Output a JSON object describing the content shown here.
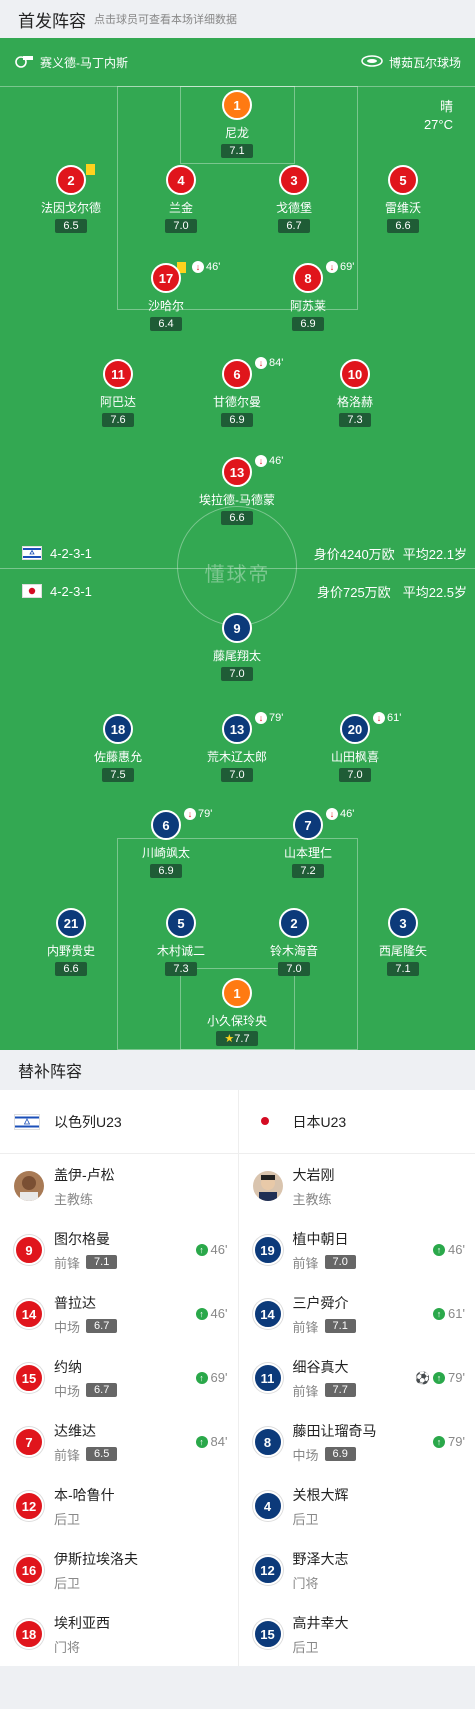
{
  "header": {
    "title": "首发阵容",
    "subtitle": "点击球员可查看本场详细数据"
  },
  "pitch": {
    "coach_left": "赛义德-马丁内斯",
    "stadium": "博茹瓦尔球场",
    "weather": "晴",
    "temperature": "27°C",
    "watermark": "懂球帝",
    "home_formation": {
      "formation": "4-2-3-1",
      "value": "身价4240万欧",
      "age": "平均22.1岁"
    },
    "away_formation": {
      "formation": "4-2-3-1",
      "value": "身价725万欧",
      "age": "平均22.5岁"
    }
  },
  "home_players": [
    {
      "num": "1",
      "name": "尼龙",
      "rating": "7.1"
    },
    {
      "num": "2",
      "name": "法因戈尔德",
      "rating": "6.5"
    },
    {
      "num": "4",
      "name": "兰金",
      "rating": "7.0"
    },
    {
      "num": "3",
      "name": "戈德堡",
      "rating": "6.7"
    },
    {
      "num": "5",
      "name": "雷维沃",
      "rating": "6.6"
    },
    {
      "num": "17",
      "name": "沙哈尔",
      "rating": "6.4",
      "sub": "46'"
    },
    {
      "num": "8",
      "name": "阿苏莱",
      "rating": "6.9",
      "sub": "69'"
    },
    {
      "num": "11",
      "name": "阿巴达",
      "rating": "7.6"
    },
    {
      "num": "6",
      "name": "甘德尔曼",
      "rating": "6.9",
      "sub": "84'"
    },
    {
      "num": "10",
      "name": "格洛赫",
      "rating": "7.3"
    },
    {
      "num": "13",
      "name": "埃拉德-马德蒙",
      "rating": "6.6",
      "sub": "46'"
    }
  ],
  "away_players": [
    {
      "num": "9",
      "name": "藤尾翔太",
      "rating": "7.0"
    },
    {
      "num": "18",
      "name": "佐藤惠允",
      "rating": "7.5"
    },
    {
      "num": "13",
      "name": "荒木辽太郎",
      "rating": "7.0",
      "sub": "79'"
    },
    {
      "num": "20",
      "name": "山田枫喜",
      "rating": "7.0",
      "sub": "61'"
    },
    {
      "num": "6",
      "name": "川崎飒太",
      "rating": "6.9",
      "sub": "79'"
    },
    {
      "num": "7",
      "name": "山本理仁",
      "rating": "7.2",
      "sub": "46'"
    },
    {
      "num": "21",
      "name": "内野贵史",
      "rating": "6.6"
    },
    {
      "num": "5",
      "name": "木村诚二",
      "rating": "7.3"
    },
    {
      "num": "2",
      "name": "铃木海音",
      "rating": "7.0"
    },
    {
      "num": "3",
      "name": "西尾隆矢",
      "rating": "7.1"
    },
    {
      "num": "1",
      "name": "小久保玲央",
      "rating": "7.7"
    }
  ],
  "subs": {
    "title": "替补阵容",
    "home_team": "以色列U23",
    "away_team": "日本U23",
    "home_coach": {
      "name": "盖伊-卢松",
      "role": "主教练"
    },
    "away_coach": {
      "name": "大岩刚",
      "role": "主教练"
    },
    "home": [
      {
        "num": "9",
        "name": "图尔格曼",
        "pos": "前锋",
        "rating": "7.1",
        "min": "46'"
      },
      {
        "num": "14",
        "name": "普拉达",
        "pos": "中场",
        "rating": "6.7",
        "min": "46'"
      },
      {
        "num": "15",
        "name": "约纳",
        "pos": "中场",
        "rating": "6.7",
        "min": "69'"
      },
      {
        "num": "7",
        "name": "达维达",
        "pos": "前锋",
        "rating": "6.5",
        "min": "84'"
      },
      {
        "num": "12",
        "name": "本-哈鲁什",
        "pos": "后卫"
      },
      {
        "num": "16",
        "name": "伊斯拉埃洛夫",
        "pos": "后卫"
      },
      {
        "num": "18",
        "name": "埃利亚西",
        "pos": "门将"
      }
    ],
    "away": [
      {
        "num": "19",
        "name": "植中朝日",
        "pos": "前锋",
        "rating": "7.0",
        "min": "46'"
      },
      {
        "num": "14",
        "name": "三户舜介",
        "pos": "前锋",
        "rating": "7.1",
        "min": "61'"
      },
      {
        "num": "11",
        "name": "细谷真大",
        "pos": "前锋",
        "rating": "7.7",
        "min": "79'",
        "goal": true
      },
      {
        "num": "8",
        "name": "藤田让瑠奇马",
        "pos": "中场",
        "rating": "6.9",
        "min": "79'"
      },
      {
        "num": "4",
        "name": "关根大辉",
        "pos": "后卫"
      },
      {
        "num": "12",
        "name": "野泽大志",
        "pos": "门将"
      },
      {
        "num": "15",
        "name": "高井幸大",
        "pos": "后卫"
      }
    ]
  },
  "colors": {
    "pitch": "#33a852",
    "home": "#e0151c",
    "away": "#0c3a7a",
    "gk": "#ff7a12"
  }
}
